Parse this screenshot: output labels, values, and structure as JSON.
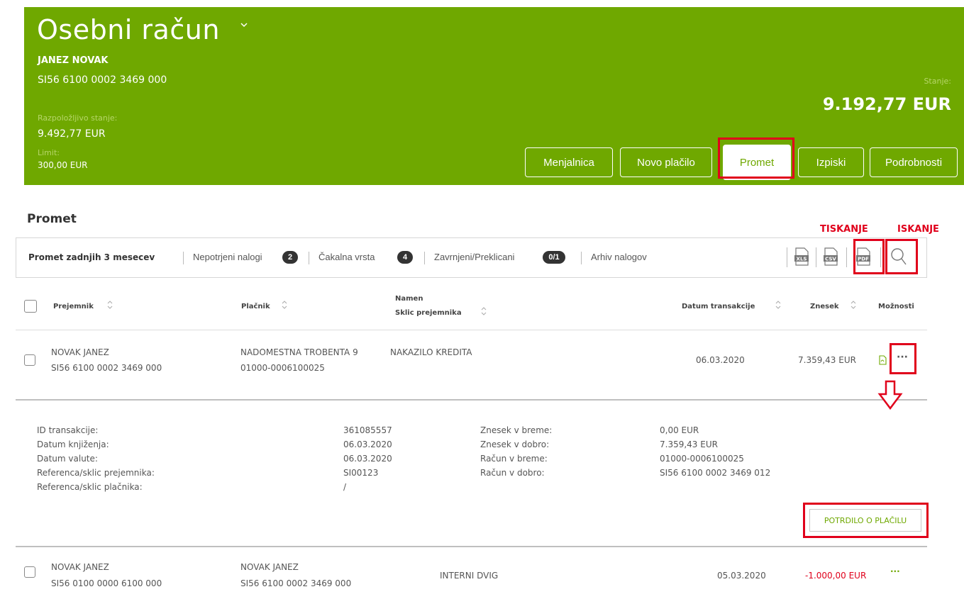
{
  "header": {
    "account_title": "Osebni račun",
    "owner": "JANEZ NOVAK",
    "iban": "SI56 6100 0002 3469 000",
    "available_label": "Razpoložljivo stanje:",
    "available_value": "9.492,77 EUR",
    "limit_label": "Limit:",
    "limit_value": "300,00 EUR",
    "balance_label": "Stanje:",
    "balance_value": "9.192,77 EUR",
    "buttons": {
      "exchange": "Menjalnica",
      "new_payment": "Novo plačilo",
      "transactions": "Promet",
      "statements": "Izpiski",
      "details": "Podrobnosti"
    },
    "accent_color": "#6fa800"
  },
  "section": {
    "title": "Promet",
    "annot_print": "TISKANJE",
    "annot_search": "ISKANJE"
  },
  "tabs": {
    "last3": "Promet zadnjih 3 mesecev",
    "unconfirmed": "Nepotrjeni nalogi",
    "unconfirmed_count": "2",
    "queue": "Čakalna vrsta",
    "queue_count": "4",
    "rejected": "Zavrnjeni/Preklicani",
    "rejected_count": "0/1",
    "archive": "Arhiv nalogov",
    "icons": [
      "xls-icon",
      "csv-icon",
      "pdf-icon",
      "search-icon"
    ]
  },
  "table": {
    "headers": {
      "recipient": "Prejemnik",
      "payer": "Plačnik",
      "purpose": "Namen",
      "ref": "Sklic prejemnika",
      "date": "Datum transakcije",
      "amount": "Znesek",
      "options": "Možnosti"
    },
    "rows": [
      {
        "recipient_name": "NOVAK JANEZ",
        "recipient_acc": "SI56 6100 0002 3469 000",
        "payer_name": "NADOMESTNA TROBENTA 9",
        "payer_acc": "01000-0006100025",
        "purpose": "NAKAZILO KREDITA",
        "date": "06.03.2020",
        "amount": "7.359,43 EUR",
        "options": "···"
      },
      {
        "recipient_name": "NOVAK JANEZ",
        "recipient_acc": "SI56 0100 0000 6100 000",
        "payer_name": "NOVAK JANEZ",
        "payer_acc": "SI56 6100 0002 3469 000",
        "purpose": "INTERNI DVIG",
        "date": "05.03.2020",
        "amount": "-1.000,00 EUR",
        "options": "···"
      }
    ]
  },
  "details": {
    "left_labels": [
      "ID transakcije:",
      "Datum knjiženja:",
      "Datum valute:",
      "Referenca/sklic prejemnika:",
      "Referenca/sklic plačnika:"
    ],
    "left_values": [
      "361085557",
      "06.03.2020",
      "06.03.2020",
      "SI00123",
      "/"
    ],
    "right_labels": [
      "Znesek v breme:",
      "Znesek v dobro:",
      "Račun v breme:",
      "Račun v dobro:"
    ],
    "right_values": [
      "0,00 EUR",
      "7.359,43 EUR",
      "01000-0006100025",
      "SI56 6100 0002 3469 012"
    ],
    "receipt_button": "POTRDILO O PLAČILU"
  }
}
